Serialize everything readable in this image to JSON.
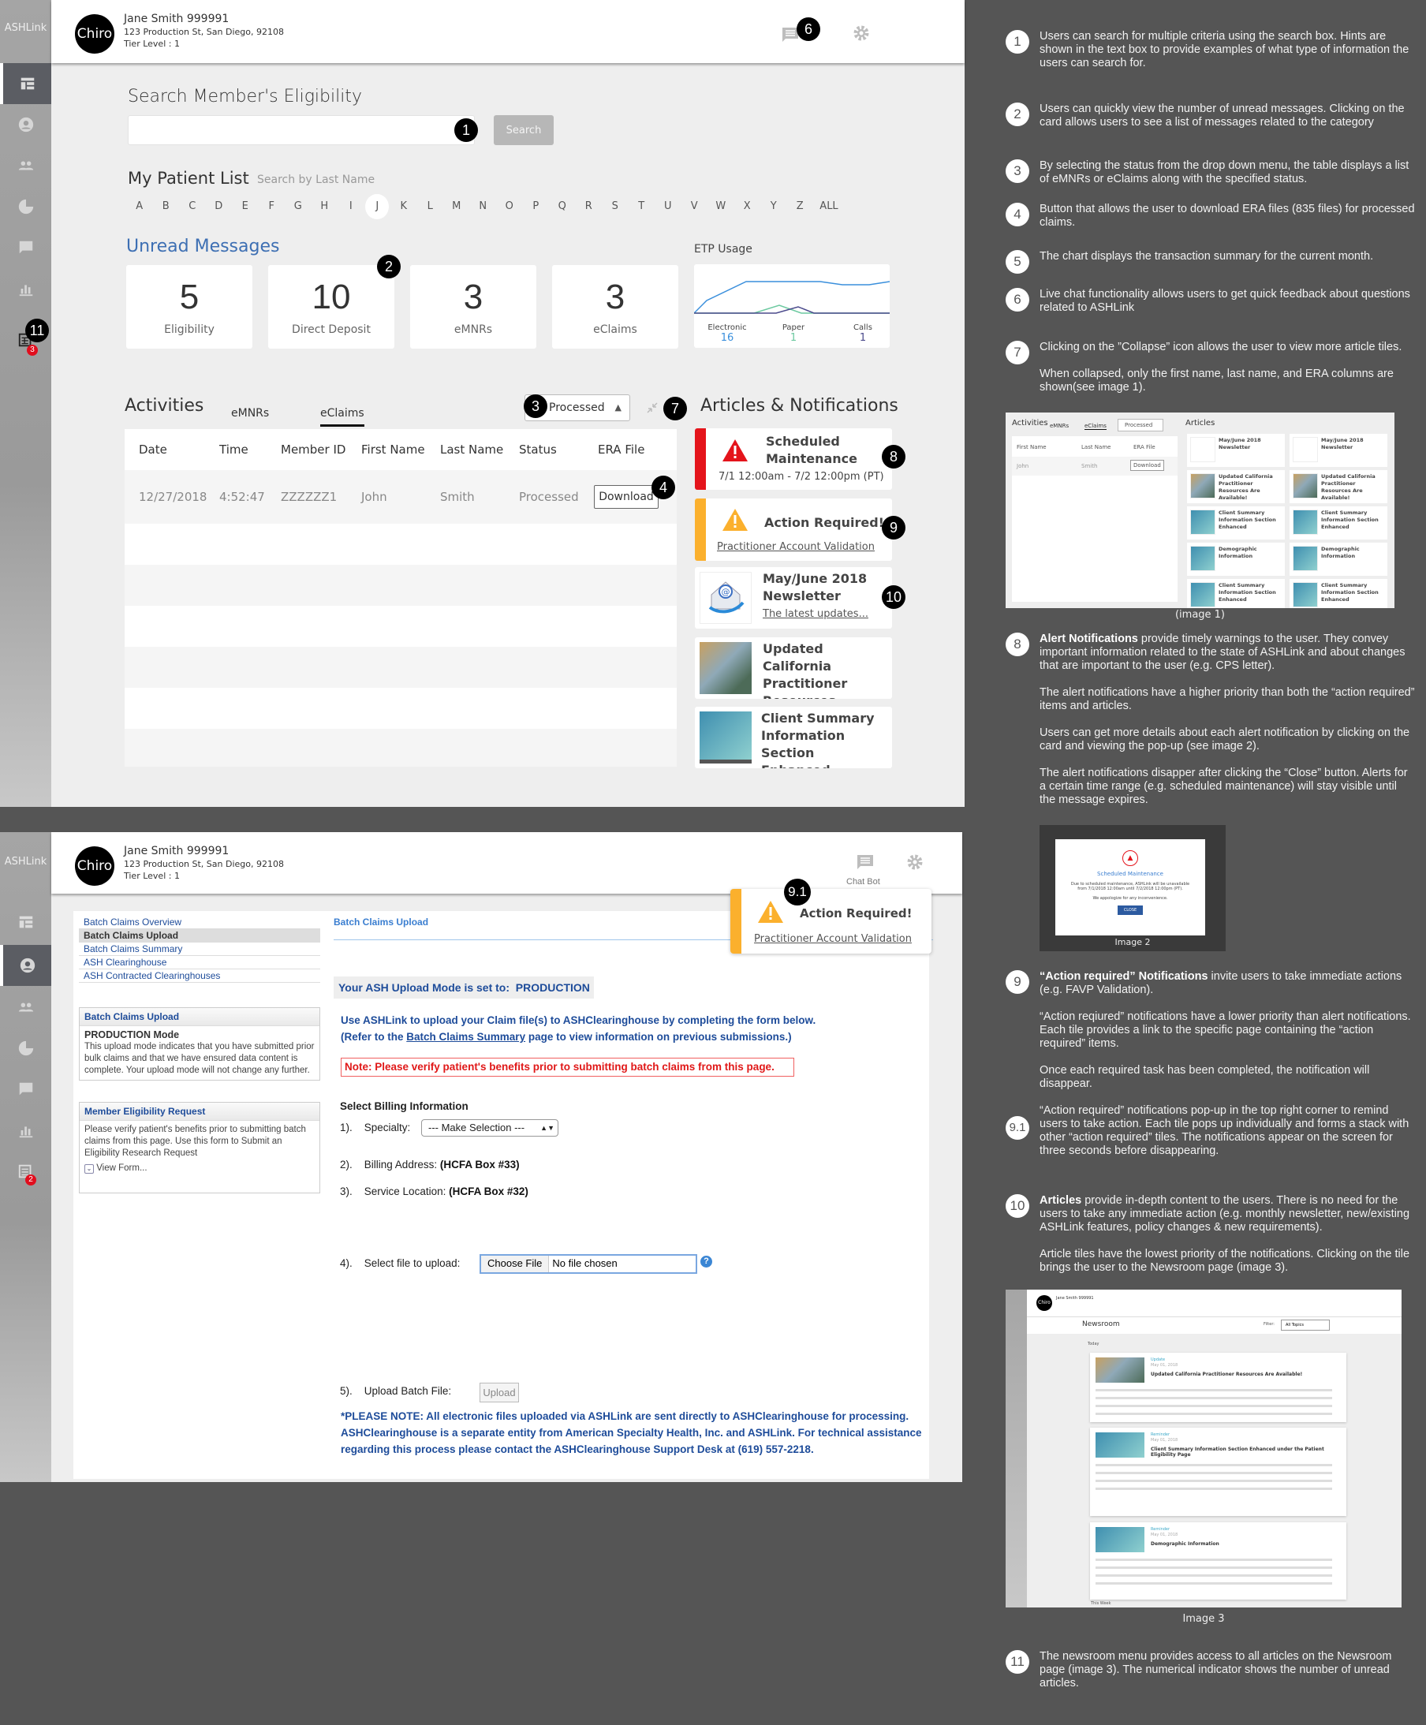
{
  "app": {
    "brand": "ASHLink",
    "avatar_label": "Chiro",
    "user_name": "Jane Smith 999991",
    "address": "123 Production St, San Diego, 92108",
    "tier": "Tier Level : 1",
    "chat_label": "Chat Bot"
  },
  "sidebar": {
    "newsroom_badge_screen1": "3",
    "newsroom_badge_screen2": "2"
  },
  "markers": [
    "1",
    "2",
    "3",
    "4",
    "5",
    "6",
    "7",
    "8",
    "9",
    "9.1",
    "10",
    "11"
  ],
  "dashboard": {
    "search_title": "Search Member's Eligibility",
    "search_placeholder": "",
    "search_button": "Search",
    "patient_list_title": "My Patient List",
    "patient_search_hint": "Search by Last Name",
    "alphabet": [
      "A",
      "B",
      "C",
      "D",
      "E",
      "F",
      "G",
      "H",
      "I",
      "J",
      "K",
      "L",
      "M",
      "N",
      "O",
      "P",
      "Q",
      "R",
      "S",
      "T",
      "U",
      "V",
      "W",
      "X",
      "Y",
      "Z",
      "ALL"
    ],
    "alphabet_selected": "J",
    "unread_title": "Unread Messages",
    "unread_cards": [
      {
        "count": "5",
        "label": "Eligibility"
      },
      {
        "count": "10",
        "label": "Direct Deposit"
      },
      {
        "count": "3",
        "label": "eMNRs"
      },
      {
        "count": "3",
        "label": "eClaims"
      }
    ],
    "etp": {
      "title": "ETP Usage",
      "legend": [
        {
          "label": "Electronic",
          "value": "16",
          "color": "#3a8fdc"
        },
        {
          "label": "Paper",
          "value": "1",
          "color": "#6cc9a0"
        },
        {
          "label": "Calls",
          "value": "1",
          "color": "#4b4a8c"
        }
      ]
    },
    "activities_title": "Activities",
    "tabs": [
      {
        "label": "eMNRs",
        "active": false
      },
      {
        "label": "eClaims",
        "active": true
      }
    ],
    "status_filter": "Processed",
    "table": {
      "columns": [
        "Date",
        "Time",
        "Member ID",
        "First Name",
        "Last Name",
        "Status",
        "ERA File"
      ],
      "rows": [
        {
          "date": "12/27/2018",
          "time": "4:52:47",
          "member_id": "ZZZZZZ1",
          "first": "John",
          "last": "Smith",
          "status": "Processed",
          "action": "Download"
        }
      ]
    },
    "articles_title": "Articles & Notifications",
    "tiles": {
      "alert_title": "Scheduled Maintenance",
      "alert_time": "7/1 12:00am - 7/2 12:00pm (PT)",
      "action_title": "Action Required!",
      "action_link": "Practitioner Account Validation",
      "newsletter_title": "May/June 2018 Newsletter",
      "newsletter_link": "The latest updates...",
      "ca_title": "Updated California Practitioner Resources",
      "client_title": "Client Summary Information Section Enhanced"
    },
    "alert_color": "#e4141b",
    "action_color": "#fbb02d"
  },
  "batch": {
    "nav": [
      "Batch Claims Overview",
      "Batch Claims Upload",
      "Batch Claims Summary",
      "ASH Clearinghouse",
      "ASH Contracted Clearinghouses"
    ],
    "nav_selected": "Batch Claims Upload",
    "box1_title": "Batch Claims Upload",
    "box1_subtitle": "PRODUCTION Mode",
    "box1_text": "This upload mode indicates that you have submitted prior bulk claims and that we have ensured data content is complete. Your upload mode will not change any further.",
    "box2_title": "Member Eligibility Request",
    "box2_text": "Please verify patient's benefits prior to submitting batch claims from this page. Use this form to Submit an Eligibility Research Request",
    "box2_link": "View Form...",
    "page_title": "Batch Claims Upload",
    "mode_label": "Your ASH Upload Mode is set to:",
    "mode_value": "PRODUCTION",
    "intro_line1": "Use ASHLink to upload your Claim file(s) to ASHClearinghouse by completing the form below.",
    "intro_line2_pre": "(Refer to the ",
    "intro_line2_link": "Batch Claims Summary",
    "intro_line2_post": " page to view information on previous submissions.)",
    "note": "Note: Please verify patient's benefits prior to submitting batch claims from this page.",
    "billing_title": "Select Billing Information",
    "step1_num": "1).",
    "step1_label": "Specialty:",
    "specialty_value": "--- Make Selection ---",
    "step2_num": "2).",
    "step2_label": "Billing Address:",
    "step2_bold": "(HCFA Box #33)",
    "step3_num": "3).",
    "step3_label": "Service Location:",
    "step3_bold": "(HCFA Box #32)",
    "step4_num": "4).",
    "step4_label": "Select file to upload:",
    "choose_file": "Choose File",
    "no_file": "No file chosen",
    "step5_num": "5).",
    "step5_label": "Upload Batch File:",
    "upload_button": "Upload",
    "footnote": "*PLEASE NOTE: All electronic files uploaded via ASHLink are sent directly to ASHClearinghouse for processing. ASHClearinghouse is a separate entity from American Specialty Health, Inc. and ASHLink. For technical assistance regarding this process please contact the ASHClearinghouse Support Desk at (619) 557-2218.",
    "popup_title": "Action Required!",
    "popup_link": "Practitioner Account Validation"
  },
  "annotations": {
    "a1": "Users can search for multiple criteria using the search box. Hints are shown in the text box to provide examples of what type of information the users can search for.",
    "a2": "Users can quickly view the number of unread messages. Clicking on the card allows users to see a list of messages related to the category",
    "a3": "By selecting the status from the drop down menu, the table displays a list of eMNRs or eClaims along with the specified status.",
    "a4": "Button that allows the user to download ERA files (835 files) for processed claims.",
    "a5": "The chart displays the transaction summary for the current month.",
    "a6": "Live chat functionality allows users to get quick feedback about questions related to ASHLink",
    "a7_p1": "Clicking on the ”Collapse” icon allows the user to view more article tiles.",
    "a7_p2": "When collapsed, only the first name, last name, and ERA columns are shown(see image 1).",
    "a8_bold": "Alert Notifications",
    "a8_p1": " provide timely warnings to the user. They convey important information related to the state of ASHLink and about changes that are important to the user (e.g. CPS letter).",
    "a8_p2": "The alert notifications have a higher priority than both the “action required” items and articles.",
    "a8_p3": "Users can get more details about each alert notification by clicking on the card and viewing the pop-up (see image 2).",
    "a8_p4": "The alert notifications disapper after clicking the “Close” button. Alerts for a certain time range (e.g. scheduled maintenance) will stay visible until the message expires.",
    "a9_bold": "“Action required” Notifications",
    "a9_p1": " invite users to take immediate actions (e.g. FAVP Validation).",
    "a9_p2": "“Action reqiured” notifications have a lower priority than alert notifications. Each tile provides a link to the specific page containing the “action required” items.",
    "a9_p3": "Once each required task has been completed, the notification will disappear.",
    "a91": "“Action required” notifications pop-up in the top right corner to remind users to take action.  Each tile pops up individually and forms a stack with other “action required” tiles. The notifications appear on the screen for three seconds before disappearing.",
    "a10_bold": "Articles",
    "a10_p1": " provide in-depth content to the users. There is no need for the users to take any immediate action (e.g. monthly newsletter, new/existing ASHLink features, policy changes & new requirements).",
    "a10_p2": "Article tiles have the lowest priority of the notifications. Clicking on the tile brings the user to the Newsroom page (image 3).",
    "a11": "The newsroom menu provides access to all articles on the Newsroom page (image 3). The numerical indicator shows the number of unread articles.",
    "image1_caption": "(image 1)",
    "image2_caption": "Image 2",
    "image3_caption": "Image 3",
    "image1": {
      "activities": "Activities",
      "tab1": "eMNRs",
      "tab2": "eClaims",
      "filter": "Processed",
      "articles": "Articles",
      "cols": [
        "First Name",
        "Last Name",
        "ERA File"
      ],
      "row": [
        "John",
        "Smith",
        "Download"
      ],
      "tiles": [
        "May/June 2018 Newsletter",
        "Updated California Practitioner Resources Are Available!",
        "Client Summary Information Section Enhanced",
        "Demographic Information",
        "Client Summary Information Section Enhanced"
      ]
    },
    "image2": {
      "title": "Scheduled Maintenance",
      "body": "Due to scheduled maintenance, ASHLink will be unavailable from 7/1/2018 12:00am until 7/2/2018 12:00pm (PT).",
      "apology": "We appologize for any inconvenience.",
      "close": "CLOSE"
    },
    "image3": {
      "title": "Newsroom",
      "filter_label": "Filter:",
      "filter_value": "All Topics",
      "today": "Today",
      "this_week": "This Week",
      "articles": [
        {
          "tag": "Update",
          "date": "May 01, 2018",
          "title": "Updated California Practitioner Resources Are Available!"
        },
        {
          "tag": "Reminder",
          "date": "May 01, 2018",
          "title": "Client Summary Information Section Enhanced under the Patient Eligibility Page"
        },
        {
          "tag": "Reminder",
          "date": "May 01, 2018",
          "title": "Demographic Information"
        }
      ]
    }
  }
}
